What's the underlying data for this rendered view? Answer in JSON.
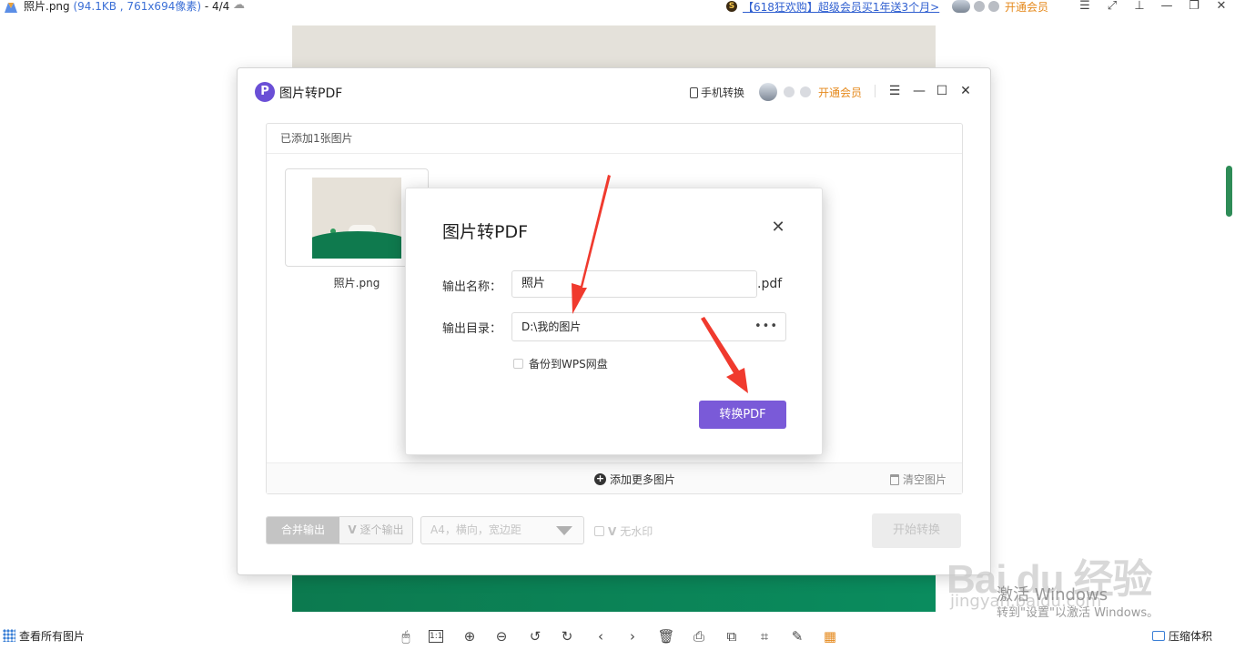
{
  "viewer": {
    "file_name": "照片.png",
    "file_meta": "(94.1KB , 761x694像素)",
    "page_indicator": "- 4/4",
    "promo_badge": "S",
    "promo_text": "【618狂欢购】超级会员买1年送3个月>",
    "vip_label": "开通会员"
  },
  "app": {
    "title": "图片转PDF",
    "logo_letter": "P",
    "phone_convert": "手机转换",
    "vip_label": "开通会员",
    "added_count": "已添加1张图片",
    "thumbnail_name": "照片.png",
    "add_more": "添加更多图片",
    "clear_images": "清空图片",
    "merge_output": "合并输出",
    "single_output": "逐个输出",
    "page_setting": "A4，横向，宽边距",
    "no_watermark": "无水印",
    "start_convert": "开始转换"
  },
  "dialog": {
    "title": "图片转PDF",
    "name_label": "输出名称：",
    "name_value": "照片",
    "name_ext": ".pdf",
    "dir_label": "输出目录：",
    "dir_value": "D:\\我的图片",
    "more_icon": "•••",
    "backup_label": "备份到WPS网盘",
    "convert_button": "转换PDF"
  },
  "watermark": {
    "brand": "Bai du 经验",
    "url": "jingyan.baidu.com"
  },
  "windows_notice": {
    "line1": "激活 Windows",
    "line2": "转到\"设置\"以激活 Windows。"
  },
  "status_bar": {
    "view_all": "查看所有图片",
    "ratio_label": "1:1",
    "compress_label": "压缩体积"
  },
  "colors": {
    "accent": "#7a5ad8",
    "vip": "#e5891c",
    "link": "#2f5fd0",
    "arrow": "#f03a2e"
  }
}
